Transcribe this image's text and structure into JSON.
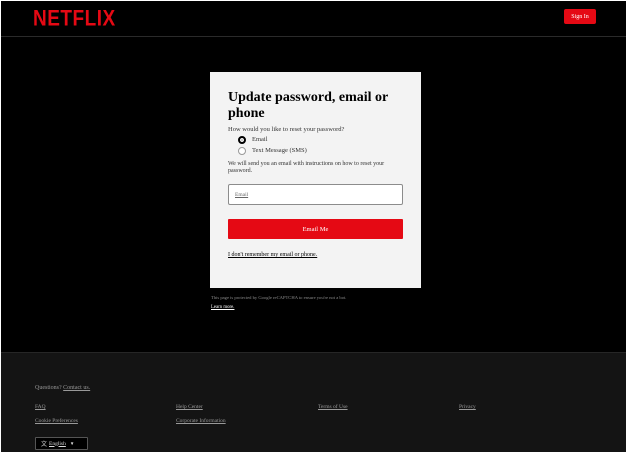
{
  "header": {
    "logo": "NETFLIX",
    "sign_in_label": "Sign In"
  },
  "card": {
    "title": "Update password, email or phone",
    "subtitle": "How would you like to reset your password?",
    "options": [
      {
        "label": "Email",
        "checked": true
      },
      {
        "label": "Text Message (SMS)",
        "checked": false
      }
    ],
    "instructions": "We will send you an email with instructions on how to reset your password.",
    "email_placeholder": "Email",
    "submit_label": "Email Me",
    "forgot_link": "I don't remember my email or phone."
  },
  "recaptcha": {
    "text": "This page is protected by Google reCAPTCHA to ensure you're not a bot.",
    "learn_more": "Learn more."
  },
  "footer": {
    "questions_text": "Questions?",
    "contact_link": "Contact us.",
    "links": [
      "FAQ",
      "Help Center",
      "Terms of Use",
      "Privacy",
      "Cookie Preferences",
      "Corporate Information"
    ],
    "language": "English"
  },
  "colors": {
    "brand_red": "#e50914",
    "background": "#000000",
    "footer_bg": "#141414"
  },
  "icons": {
    "language": "translate-icon",
    "caret": "caret-down-icon"
  }
}
